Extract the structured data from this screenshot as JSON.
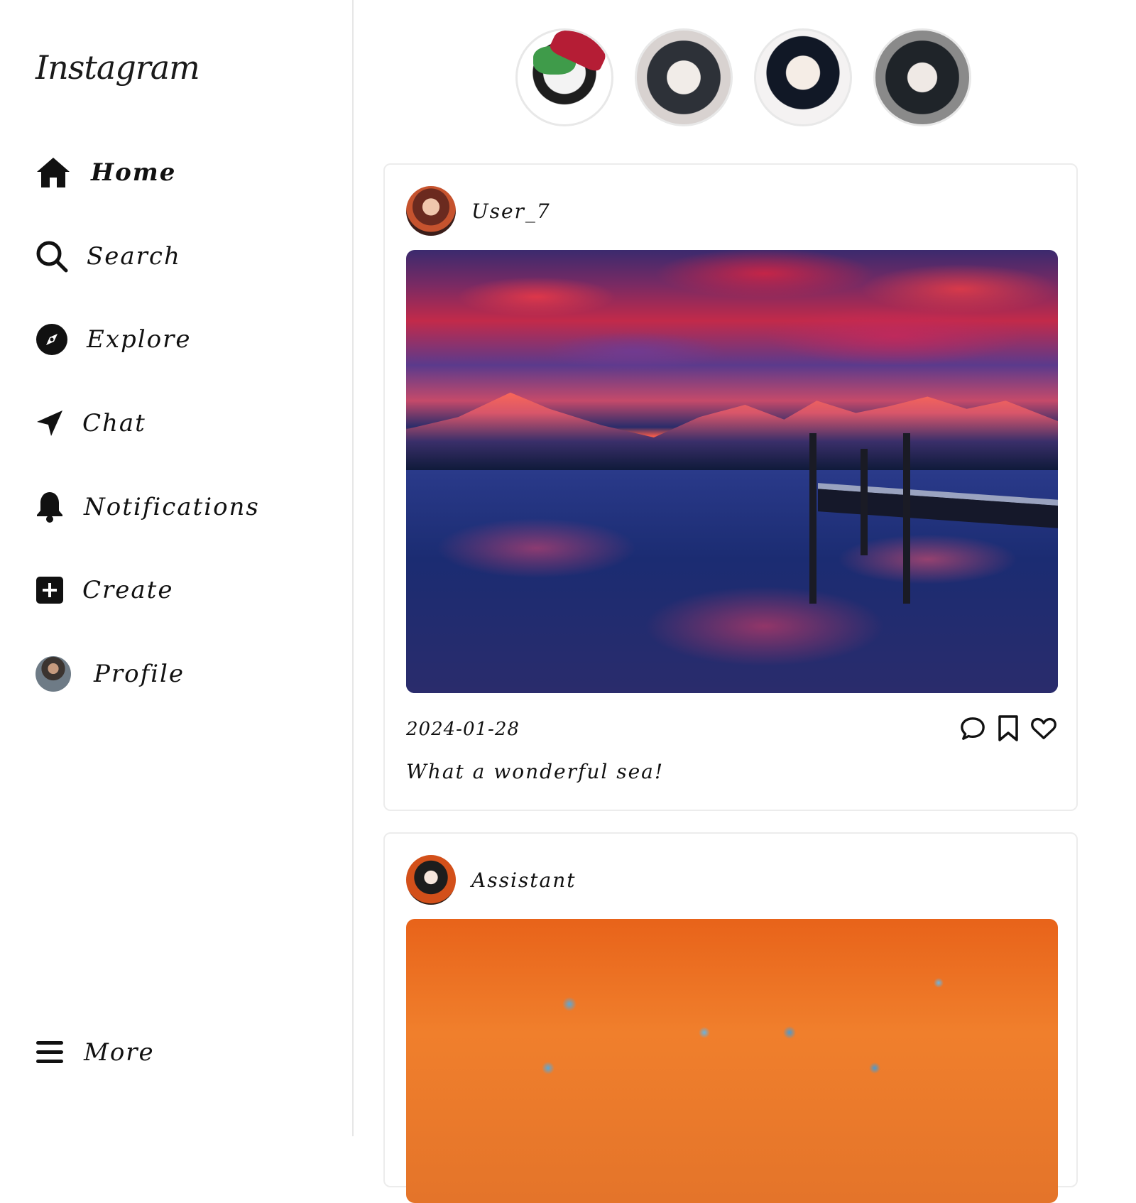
{
  "app": {
    "logo": "Instagram"
  },
  "sidebar": {
    "items": [
      {
        "label": "Home",
        "icon": "home-icon",
        "active": true
      },
      {
        "label": "Search",
        "icon": "search-icon"
      },
      {
        "label": "Explore",
        "icon": "compass-icon"
      },
      {
        "label": "Chat",
        "icon": "send-icon"
      },
      {
        "label": "Notifications",
        "icon": "bell-icon"
      },
      {
        "label": "Create",
        "icon": "plus-square-icon"
      },
      {
        "label": "Profile",
        "icon": "avatar"
      }
    ],
    "more": {
      "label": "More",
      "icon": "menu-icon"
    }
  },
  "stories": [
    {
      "name": "story-1"
    },
    {
      "name": "story-2"
    },
    {
      "name": "story-3"
    },
    {
      "name": "story-4"
    }
  ],
  "posts": [
    {
      "username": "User_7",
      "date": "2024-01-28",
      "caption": "What a wonderful sea!",
      "image": "lake-sunset-mountains"
    },
    {
      "username": "Assistant",
      "image": "orange-field-blue-flowers"
    }
  ]
}
